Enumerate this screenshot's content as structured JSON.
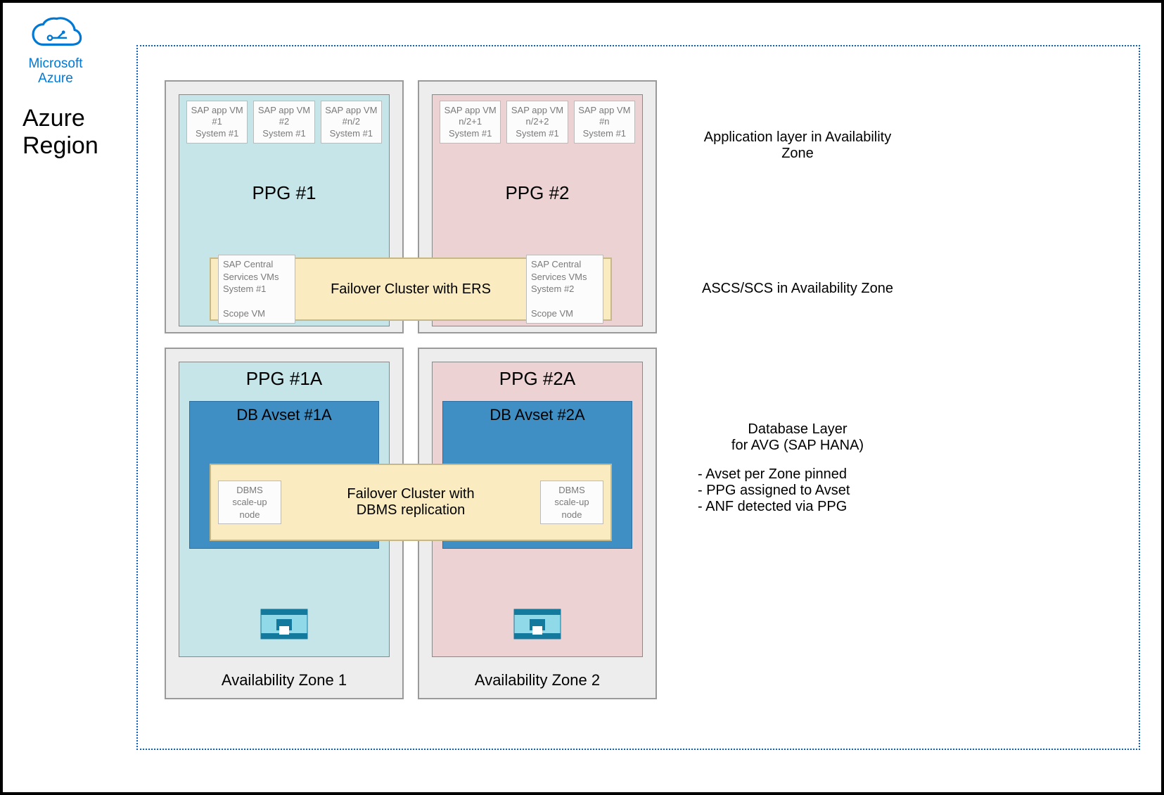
{
  "header": {
    "logo_text": "Microsoft\nAzure",
    "region_text": "Azure\nRegion"
  },
  "zones": {
    "zone1_label": "Availability Zone 1",
    "zone2_label": "Availability Zone 2"
  },
  "ppg1": {
    "title": "PPG #1",
    "vms": [
      "SAP app VM\n#1\nSystem #1",
      "SAP app VM\n#2\nSystem #1",
      "SAP app VM\n#n/2\nSystem #1"
    ]
  },
  "ppg2": {
    "title": "PPG #2",
    "vms": [
      "SAP app VM\nn/2+1\nSystem #1",
      "SAP app VM\nn/2+2\nSystem #1",
      "SAP app VM\n#n\nSystem #1"
    ]
  },
  "ppg1a": {
    "title": "PPG #1A",
    "avset_title": "DB Avset #1A"
  },
  "ppg2a": {
    "title": "PPG #2A",
    "avset_title": "DB Avset #2A"
  },
  "failover_ers": {
    "label": "Failover Cluster with ERS",
    "left_box": "SAP Central\nServices VMs\nSystem #1\n\nScope VM",
    "right_box": "SAP Central\nServices VMs\nSystem #2\n\nScope VM"
  },
  "failover_db": {
    "label": "Failover Cluster with\nDBMS replication",
    "left_box": "DBMS\nscale-up\nnode",
    "right_box": "DBMS\nscale-up\nnode"
  },
  "side": {
    "app_layer": "Application layer in Availability\nZone",
    "ascs": "ASCS/SCS in Availability Zone",
    "db_header": "Database Layer\nfor AVG (SAP HANA)",
    "db_bullets": [
      "Avset per Zone pinned",
      "PPG assigned to Avset",
      "ANF detected via PPG"
    ]
  }
}
